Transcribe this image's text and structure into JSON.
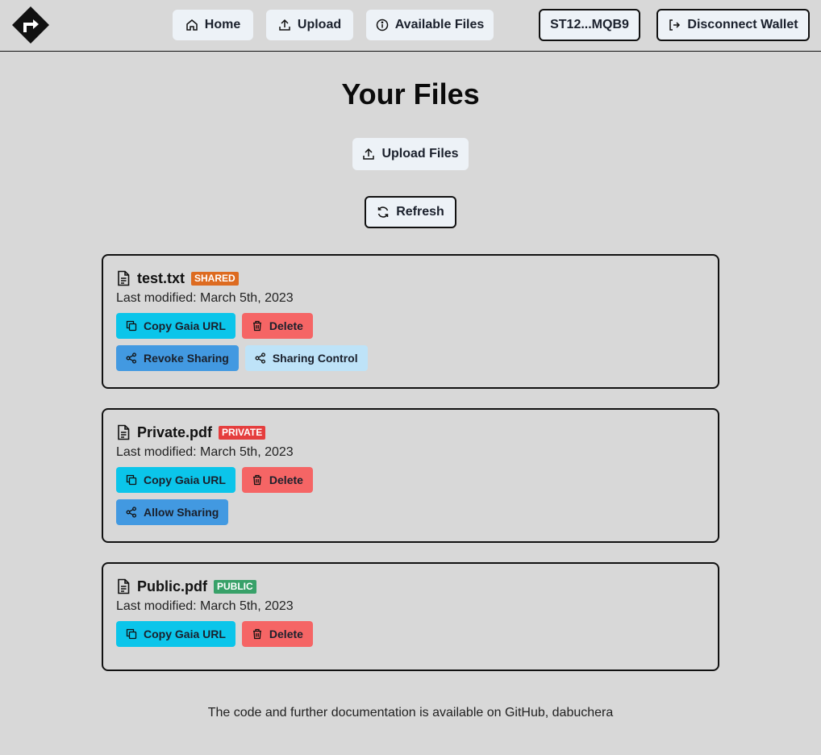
{
  "nav": {
    "home": "Home",
    "upload": "Upload",
    "available": "Available Files",
    "wallet": "ST12...MQB9",
    "disconnect": "Disconnect Wallet"
  },
  "main": {
    "title": "Your Files",
    "upload_files": "Upload Files",
    "refresh": "Refresh"
  },
  "files": [
    {
      "name": "test.txt",
      "badge": "SHARED",
      "modified": "Last modified: March 5th, 2023",
      "copy": "Copy Gaia URL",
      "delete": "Delete",
      "revoke": "Revoke Sharing",
      "control": "Sharing Control"
    },
    {
      "name": "Private.pdf",
      "badge": "PRIVATE",
      "modified": "Last modified: March 5th, 2023",
      "copy": "Copy Gaia URL",
      "delete": "Delete",
      "allow": "Allow Sharing"
    },
    {
      "name": "Public.pdf",
      "badge": "PUBLIC",
      "modified": "Last modified: March 5th, 2023",
      "copy": "Copy Gaia URL",
      "delete": "Delete"
    }
  ],
  "footer": "The code and further documentation is available on GitHub, dabuchera",
  "colors": {
    "background": "#d8d8d8",
    "copy_button": "#0bc5ea",
    "delete_button": "#f56565",
    "share_button": "#4299e1",
    "sharing_control": "#bee3f8",
    "badge_shared": "#dd6b20",
    "badge_private": "#e53e3e",
    "badge_public": "#38a169"
  }
}
